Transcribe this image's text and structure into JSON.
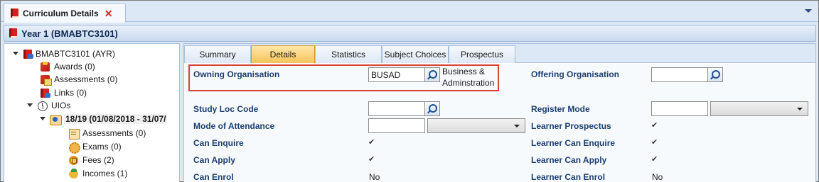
{
  "window": {
    "tab_title": "Curriculum Details",
    "close_glyph": "✕"
  },
  "header": {
    "title": "Year 1 (BMABTC3101)"
  },
  "tree": {
    "root": "BMABTC3101 (AYR)",
    "awards": "Awards (0)",
    "assessments": "Assessments (0)",
    "links": "Links (0)",
    "uios": "UIOs",
    "period": "18/19 (01/08/2018 - 31/07/",
    "period_assessments": "Assessments (0)",
    "exams": "Exams (0)",
    "fees": "Fees (2)",
    "incomes": "Incomes (1)"
  },
  "tabs": [
    "Summary",
    "Details",
    "Statistics",
    "Subject Choices",
    "Prospectus"
  ],
  "active_tab": "Details",
  "form": {
    "owning_org_label": "Owning Organisation",
    "owning_org_value": "BUSAD",
    "owning_org_desc_1": "Business &",
    "owning_org_desc_2": "Adminstration",
    "offering_org_label": "Offering Organisation",
    "offering_org_value": "",
    "study_loc_label": "Study Loc Code",
    "study_loc_value": "",
    "register_mode_label": "Register Mode",
    "register_mode_value": "",
    "mode_attendance_label": "Mode of Attendance",
    "mode_attendance_value": "",
    "learner_prospectus_label": "Learner Prospectus",
    "can_enquire_label": "Can Enquire",
    "learner_can_enquire_label": "Learner Can Enquire",
    "can_apply_label": "Can Apply",
    "learner_can_apply_label": "Learner Can Apply",
    "can_enrol_label": "Can Enrol",
    "can_enrol_value": "No",
    "learner_can_enrol_label": "Learner Can Enrol",
    "learner_can_enrol_value": "No",
    "check_glyph": "✔"
  },
  "colors": {
    "accent_tab": "#f7c45a",
    "highlight_border": "#d9433a",
    "label_text": "#1c3e6e"
  }
}
